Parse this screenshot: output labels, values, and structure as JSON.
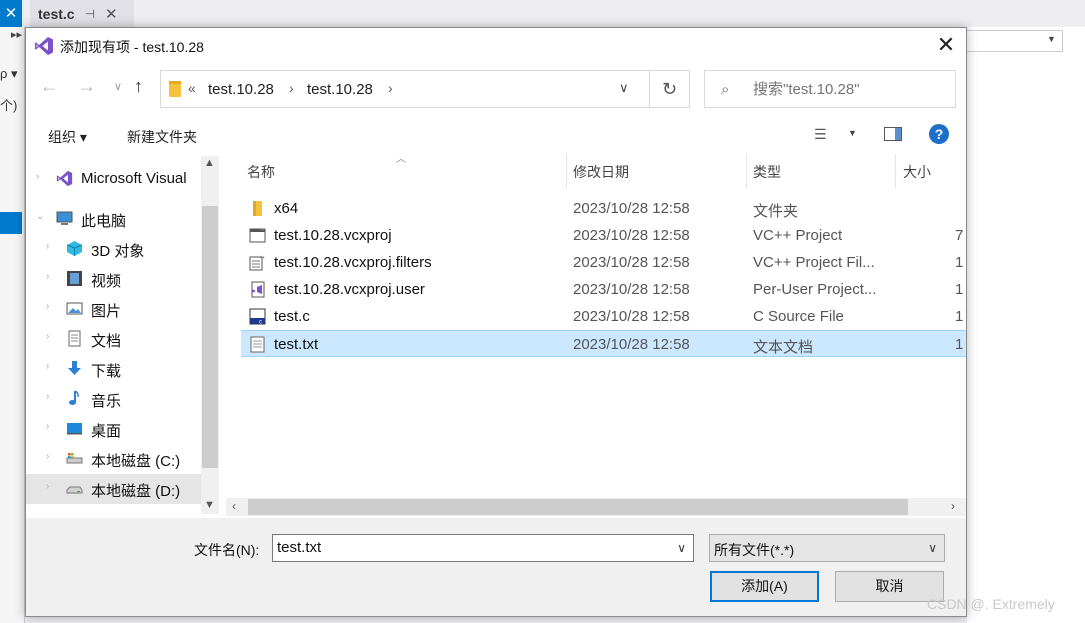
{
  "ide": {
    "tab_title": "test.c",
    "tab_pin": "⊣",
    "tab_close": "✕",
    "left_blue_glyph": "✕",
    "left_dots": "▸▸",
    "left_text1": "ρ ▾",
    "left_text2": "个)"
  },
  "dialog": {
    "title": "添加现有项 - test.10.28",
    "close": "✕"
  },
  "nav": {
    "back": "←",
    "forward": "→",
    "recent": "∨",
    "up": "↑",
    "chevron": "«",
    "breadcrumbs": [
      "test.10.28",
      "test.10.28"
    ],
    "sep": "›",
    "dropdown": "∨",
    "refresh": "↻",
    "search_placeholder": "搜索\"test.10.28\"",
    "search_icon": "⌕"
  },
  "toolbar": {
    "organize": "组织 ▾",
    "new_folder": "新建文件夹",
    "view_icon": "☰",
    "view_arrow": "▼",
    "help": "?"
  },
  "sidebar": {
    "items": [
      {
        "label": "Microsoft Visual",
        "icon": "visual-studio-icon",
        "indent": 0
      },
      {
        "label": "此电脑",
        "icon": "computer-icon",
        "indent": 0
      },
      {
        "label": "3D 对象",
        "icon": "3d-objects-icon",
        "indent": 1
      },
      {
        "label": "视频",
        "icon": "video-icon",
        "indent": 1
      },
      {
        "label": "图片",
        "icon": "pictures-icon",
        "indent": 1
      },
      {
        "label": "文档",
        "icon": "documents-icon",
        "indent": 1
      },
      {
        "label": "下载",
        "icon": "download-icon",
        "indent": 1
      },
      {
        "label": "音乐",
        "icon": "music-icon",
        "indent": 1
      },
      {
        "label": "桌面",
        "icon": "desktop-icon",
        "indent": 1
      },
      {
        "label": "本地磁盘 (C:)",
        "icon": "drive-c-icon",
        "indent": 1
      },
      {
        "label": "本地磁盘 (D:)",
        "icon": "drive-d-icon",
        "indent": 1,
        "selected": true
      }
    ]
  },
  "columns": {
    "name": "名称",
    "date": "修改日期",
    "type": "类型",
    "size": "大小"
  },
  "files": [
    {
      "name": "x64",
      "date": "2023/10/28 12:58",
      "type": "文件夹",
      "size": "",
      "icon": "folder-icon"
    },
    {
      "name": "test.10.28.vcxproj",
      "date": "2023/10/28 12:58",
      "type": "VC++ Project",
      "size": "7",
      "icon": "vcxproj-icon"
    },
    {
      "name": "test.10.28.vcxproj.filters",
      "date": "2023/10/28 12:58",
      "type": "VC++ Project Fil...",
      "size": "1",
      "icon": "filters-icon"
    },
    {
      "name": "test.10.28.vcxproj.user",
      "date": "2023/10/28 12:58",
      "type": "Per-User Project...",
      "size": "1",
      "icon": "user-file-icon"
    },
    {
      "name": "test.c",
      "date": "2023/10/28 12:58",
      "type": "C Source File",
      "size": "1",
      "icon": "c-source-icon"
    },
    {
      "name": "test.txt",
      "date": "2023/10/28 12:58",
      "type": "文本文档",
      "size": "1",
      "icon": "text-file-icon",
      "selected": true
    }
  ],
  "bottom": {
    "filename_label": "文件名(N):",
    "filename_value": "test.txt",
    "filetype": "所有文件(*.*)",
    "add_button": "添加(A)",
    "cancel_button": "取消",
    "arrow": "∨"
  },
  "watermark": "CSDN @. Extremely",
  "colors": {
    "accent": "#0078d7",
    "selection": "#cce8ff",
    "ide_blue": "#007acc"
  }
}
